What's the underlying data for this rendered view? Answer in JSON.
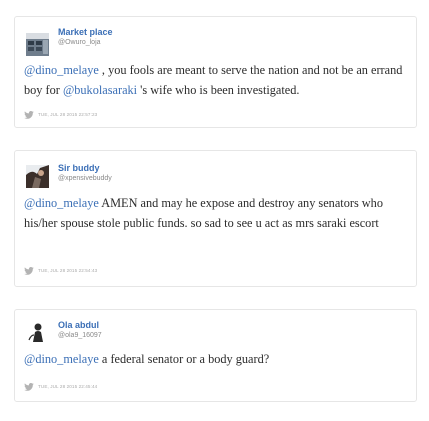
{
  "tweets": [
    {
      "name": "Market place",
      "handle": "@Owuro_loja",
      "mention": "@dino_melaye",
      "text_a": " , you fools are meant to serve the nation and not be an errand boy for ",
      "mention_2": "@bukolasaraki",
      "text_b": " 's wife who is been investigated.",
      "date": "TUE, JUL 28 2015 22:57:23",
      "avatar_icon": "building-avatar-icon",
      "bird_icon": "twitter-bird-icon"
    },
    {
      "name": "Sir buddy",
      "handle": "@xpensivebuddy",
      "mention": "@dino_melaye",
      "text_a": " AMEN and may he expose and destroy any senators who his/her spouse stole public funds. so sad to see u act as mrs saraki escort",
      "date": "TUE, JUL 28 2015 22:54:43",
      "avatar_icon": "person-avatar-icon",
      "bird_icon": "twitter-bird-icon"
    },
    {
      "name": "Ola abdul",
      "handle": "@ola9_16097",
      "mention": "@dino_melaye",
      "text_a": " a federal senator or a body guard?",
      "date": "TUE, JUL 28 2015 22:45:44",
      "avatar_icon": "silhouette-avatar-icon",
      "bird_icon": "twitter-bird-icon"
    }
  ],
  "colors": {
    "link": "#3b6fb6",
    "text": "#2b2b2b",
    "meta": "#aaaaaa",
    "border": "#e6e6e6"
  }
}
